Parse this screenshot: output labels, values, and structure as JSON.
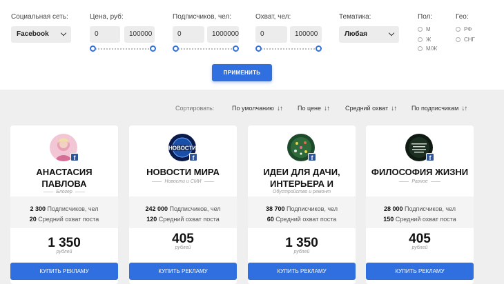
{
  "filters": {
    "social": {
      "label": "Социальная сеть:",
      "value": "Facebook"
    },
    "price": {
      "label": "Цена, руб:",
      "min": "0",
      "max": "100000",
      "range": [
        0,
        1
      ]
    },
    "subscribers": {
      "label": "Подписчиков, чел:",
      "min": "0",
      "max": "1000000",
      "range": [
        0,
        1
      ]
    },
    "reach": {
      "label": "Охват, чел:",
      "min": "0",
      "max": "100000",
      "range": [
        0,
        1
      ]
    },
    "topic": {
      "label": "Тематика:",
      "value": "Любая"
    },
    "gender": {
      "label": "Пол:",
      "options": [
        "М",
        "Ж",
        "М/Ж"
      ]
    },
    "geo": {
      "label": "Гео:",
      "options": [
        "РФ",
        "СНГ"
      ]
    },
    "apply_label": "ПРИМЕНИТЬ"
  },
  "sort": {
    "label": "Сортировать:",
    "options": [
      "По умолчанию",
      "По цене",
      "Средний охват",
      "По подписчикам"
    ],
    "arrows": "↓↑"
  },
  "cards": [
    {
      "name": "АНАСТАСИЯ ПАВЛОВА",
      "category": "Блогер",
      "subscribers": "2 300",
      "subscribers_label": "Подписчиков, чел",
      "reach": "20",
      "reach_label": "Средний охват поста",
      "price": "1 350",
      "currency": "рублей",
      "button": "КУПИТЬ РЕКЛАМУ",
      "badge": "f"
    },
    {
      "name": "НОВОСТИ МИРА",
      "category": "Новости и СМИ",
      "subscribers": "242 000",
      "subscribers_label": "Подписчиков, чел",
      "reach": "120",
      "reach_label": "Средний охват поста",
      "price": "405",
      "currency": "рублей",
      "button": "КУПИТЬ РЕКЛАМУ",
      "badge": "f",
      "avatar_text": "НОВОСТИ"
    },
    {
      "name": "ИДЕИ ДЛЯ ДАЧИ, ИНТЕРЬЕРА И",
      "category": "Обустройство и ремонт",
      "subscribers": "38 700",
      "subscribers_label": "Подписчиков, чел",
      "reach": "60",
      "reach_label": "Средний охват поста",
      "price": "1 350",
      "currency": "рублей",
      "button": "КУПИТЬ РЕКЛАМУ",
      "badge": "f"
    },
    {
      "name": "ФИЛОСОФИЯ ЖИЗНИ",
      "category": "Разное",
      "subscribers": "28 000",
      "subscribers_label": "Подписчиков, чел",
      "reach": "150",
      "reach_label": "Средний охват поста",
      "price": "405",
      "currency": "рублей",
      "button": "КУПИТЬ РЕКЛАМУ",
      "badge": "f"
    }
  ],
  "colors": {
    "accent": "#2f6fe0",
    "pink": "#e8336c",
    "facebook": "#2f5597"
  }
}
